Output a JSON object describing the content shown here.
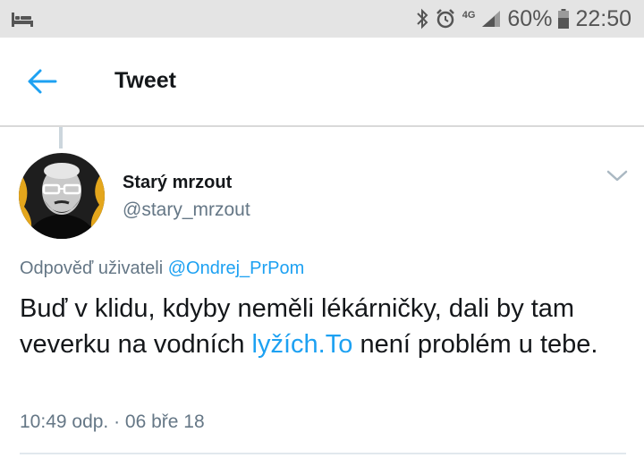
{
  "status_bar": {
    "battery": "60%",
    "time": "22:50",
    "network": "4G"
  },
  "toolbar": {
    "title": "Tweet"
  },
  "tweet": {
    "author_name": "Starý mrzout",
    "author_handle": "@stary_mrzout",
    "reply_prefix": "Odpověď uživateli",
    "reply_to": "@Ondrej_PrPom",
    "text_before_link": "Buď v klidu, kdyby neměli lékárničky, dali by tam veverku na vodních",
    "link_text": "lyžích.To",
    "text_after_link": "není problém u tebe.",
    "timestamp": "10:49 odp. · 06 bře 18"
  },
  "colors": {
    "accent": "#1da1f2",
    "text": "#14171a",
    "muted": "#657786",
    "status_bar_bg": "#e4e4e4"
  },
  "icons": [
    "bed-icon",
    "bluetooth-icon",
    "alarm-icon",
    "signal-icon",
    "battery-icon",
    "back-arrow-icon",
    "chevron-down-icon"
  ]
}
